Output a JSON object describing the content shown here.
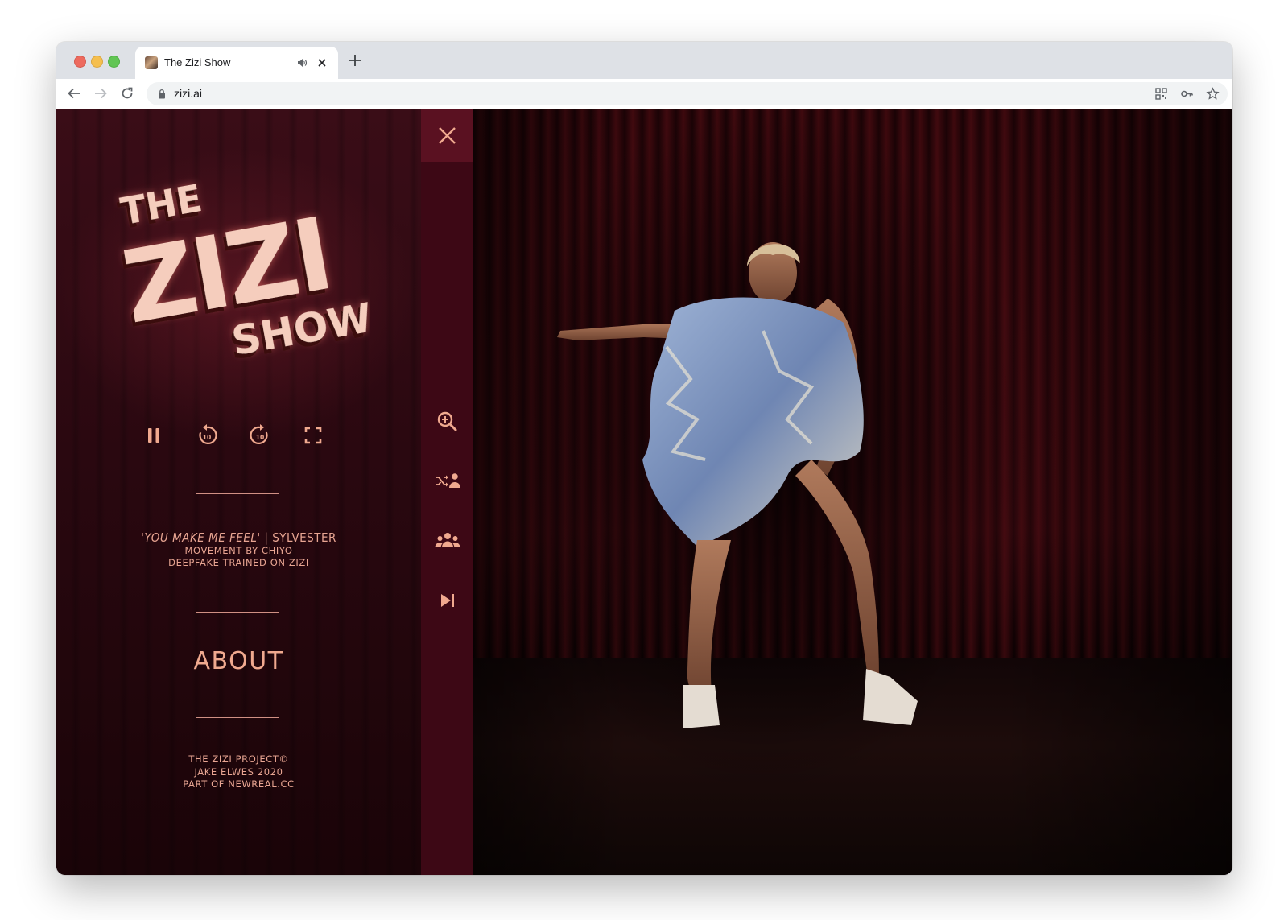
{
  "browser": {
    "tab_title": "The Zizi Show",
    "url": "zizi.ai"
  },
  "logo": {
    "line1": "THE",
    "line2": "ZIZI",
    "line3": "SHOW"
  },
  "now_playing": {
    "song": "'YOU MAKE ME FEEL'",
    "separator": " | ",
    "artist": "SYLVESTER",
    "movement": "MOVEMENT BY CHIYO",
    "deepfake": "DEEPFAKE TRAINED ON ZIZI"
  },
  "about_label": "ABOUT",
  "footer": {
    "line1": "THE ZIZI PROJECT©",
    "line2": "JAKE ELWES 2020",
    "line3": "PART OF NEWREAL.CC"
  },
  "colors": {
    "accent": "#f0a98f",
    "sidebar_bg": "#2a0810",
    "toolbar_bg": "#3d0815",
    "close_bg": "#5a1121"
  },
  "icons": {
    "controls": [
      "pause-icon",
      "rewind-10-icon",
      "forward-10-icon",
      "fullscreen-icon"
    ],
    "side_tools": [
      "zoom-in-icon",
      "shuffle-performer-icon",
      "group-icon",
      "skip-next-icon"
    ]
  }
}
